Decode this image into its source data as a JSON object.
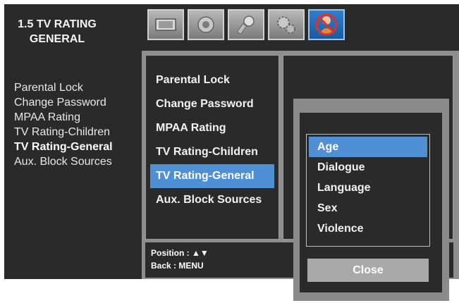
{
  "help_panel": {
    "title_line1": "1.5 TV RATING",
    "title_line2": "GENERAL",
    "items": [
      {
        "label": "Parental Lock"
      },
      {
        "label": "Change Password"
      },
      {
        "label": "MPAA Rating"
      },
      {
        "label": "TV Rating-Children"
      },
      {
        "label": "TV Rating-General",
        "active": true
      },
      {
        "label": "Aux. Block Sources"
      }
    ]
  },
  "tabs": [
    {
      "icon": "picture-icon"
    },
    {
      "icon": "sound-icon"
    },
    {
      "icon": "setup-icon"
    },
    {
      "icon": "settings-gears-icon"
    },
    {
      "icon": "parental-lock-icon",
      "active": true
    }
  ],
  "menu": {
    "items": [
      {
        "label": "Parental Lock"
      },
      {
        "label": "Change Password"
      },
      {
        "label": "MPAA Rating"
      },
      {
        "label": "TV Rating-Children"
      },
      {
        "label": "TV Rating-General",
        "selected": true
      },
      {
        "label": "Aux. Block Sources"
      }
    ]
  },
  "hint": {
    "position": "Position : ▲▼",
    "back": "Back : MENU"
  },
  "popup": {
    "options": [
      {
        "label": "Age",
        "selected": true
      },
      {
        "label": "Dialogue"
      },
      {
        "label": "Language"
      },
      {
        "label": "Sex"
      },
      {
        "label": "Violence"
      }
    ],
    "close_label": "Close"
  },
  "colors": {
    "panel_bg": "#2a2a2a",
    "highlight": "#4f90d4",
    "frame": "#8e8e8e",
    "active_tab": "#1b5aa0"
  }
}
